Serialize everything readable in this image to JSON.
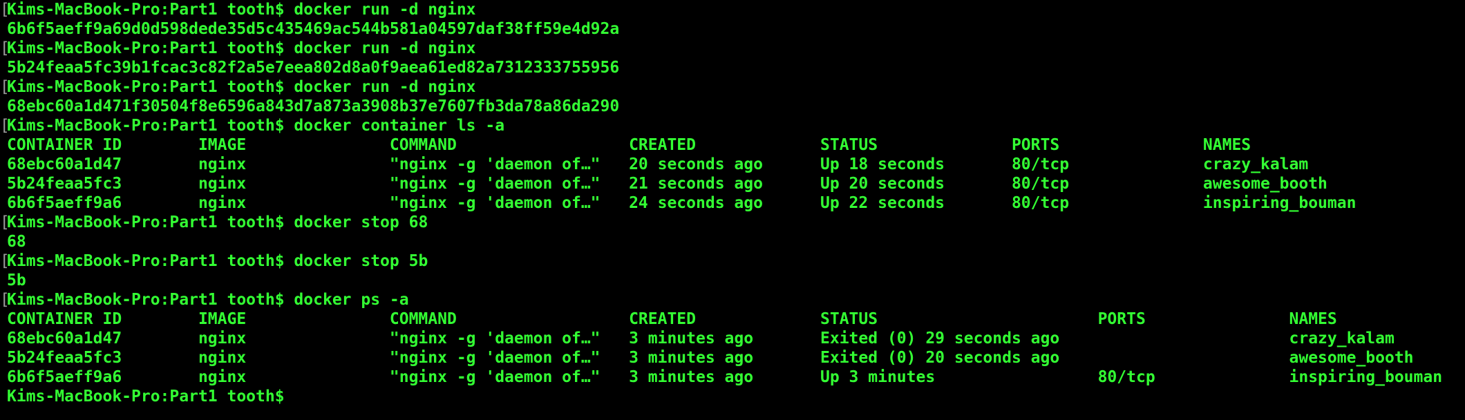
{
  "terminal": {
    "bracket_char": "[",
    "lines": [
      {
        "bracket": true,
        "prompt": "Kims-MacBook-Pro:Part1 tooth$",
        "command": " docker run -d nginx",
        "output": ""
      },
      {
        "bracket": false,
        "prompt": "",
        "command": "",
        "output": "6b6f5aeff9a69d0d598dede35d5c435469ac544b581a04597daf38ff59e4d92a"
      },
      {
        "bracket": true,
        "prompt": "Kims-MacBook-Pro:Part1 tooth$",
        "command": " docker run -d nginx",
        "output": ""
      },
      {
        "bracket": false,
        "prompt": "",
        "command": "",
        "output": "5b24feaa5fc39b1fcac3c82f2a5e7eea802d8a0f9aea61ed82a7312333755956"
      },
      {
        "bracket": true,
        "prompt": "Kims-MacBook-Pro:Part1 tooth$",
        "command": " docker run -d nginx",
        "output": ""
      },
      {
        "bracket": false,
        "prompt": "",
        "command": "",
        "output": "68ebc60a1d471f30504f8e6596a843d7a873a3908b37e7607fb3da78a86da290"
      },
      {
        "bracket": true,
        "prompt": "Kims-MacBook-Pro:Part1 tooth$",
        "command": " docker container ls -a",
        "output": ""
      },
      {
        "bracket": false,
        "prompt": "",
        "command": "",
        "output": "CONTAINER ID        IMAGE               COMMAND                  CREATED             STATUS              PORTS               NAMES"
      },
      {
        "bracket": false,
        "prompt": "",
        "command": "",
        "output": "68ebc60a1d47        nginx               \"nginx -g 'daemon of…\"   20 seconds ago      Up 18 seconds       80/tcp              crazy_kalam"
      },
      {
        "bracket": false,
        "prompt": "",
        "command": "",
        "output": "5b24feaa5fc3        nginx               \"nginx -g 'daemon of…\"   21 seconds ago      Up 20 seconds       80/tcp              awesome_booth"
      },
      {
        "bracket": false,
        "prompt": "",
        "command": "",
        "output": "6b6f5aeff9a6        nginx               \"nginx -g 'daemon of…\"   24 seconds ago      Up 22 seconds       80/tcp              inspiring_bouman"
      },
      {
        "bracket": true,
        "prompt": "Kims-MacBook-Pro:Part1 tooth$",
        "command": " docker stop 68",
        "output": ""
      },
      {
        "bracket": false,
        "prompt": "",
        "command": "",
        "output": "68"
      },
      {
        "bracket": true,
        "prompt": "Kims-MacBook-Pro:Part1 tooth$",
        "command": " docker stop 5b",
        "output": ""
      },
      {
        "bracket": false,
        "prompt": "",
        "command": "",
        "output": "5b"
      },
      {
        "bracket": true,
        "prompt": "Kims-MacBook-Pro:Part1 tooth$",
        "command": " docker ps -a",
        "output": ""
      },
      {
        "bracket": false,
        "prompt": "",
        "command": "",
        "output": "CONTAINER ID        IMAGE               COMMAND                  CREATED             STATUS                       PORTS               NAMES"
      },
      {
        "bracket": false,
        "prompt": "",
        "command": "",
        "output": "68ebc60a1d47        nginx               \"nginx -g 'daemon of…\"   3 minutes ago       Exited (0) 29 seconds ago                        crazy_kalam"
      },
      {
        "bracket": false,
        "prompt": "",
        "command": "",
        "output": "5b24feaa5fc3        nginx               \"nginx -g 'daemon of…\"   3 minutes ago       Exited (0) 20 seconds ago                        awesome_booth"
      },
      {
        "bracket": false,
        "prompt": "",
        "command": "",
        "output": "6b6f5aeff9a6        nginx               \"nginx -g 'daemon of…\"   3 minutes ago       Up 3 minutes                 80/tcp              inspiring_bouman"
      },
      {
        "bracket": false,
        "prompt": "Kims-MacBook-Pro:Part1 tooth$",
        "command": "",
        "output": ""
      }
    ]
  },
  "colors": {
    "background": "#000000",
    "text": "#33ff33",
    "bracket": "#9a9a9a"
  }
}
